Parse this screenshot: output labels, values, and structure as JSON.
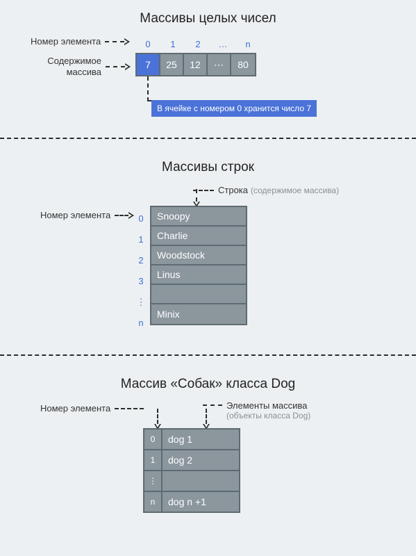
{
  "section1": {
    "title": "Массивы целых чисел",
    "label_index": "Номер элемента",
    "label_content": "Содержимое массива",
    "indices": [
      "0",
      "1",
      "2",
      "…",
      "n"
    ],
    "cells": [
      "7",
      "25",
      "12",
      "⋯",
      "80"
    ],
    "callout": "В ячейке с номером 0 хранится число 7"
  },
  "section2": {
    "title": "Массивы строк",
    "label_top_main": "Строка",
    "label_top_sub": "(содержимое массива)",
    "label_left": "Номер элемента",
    "indices": [
      "0",
      "1",
      "2",
      "3",
      "⋮",
      "n"
    ],
    "rows": [
      "Snoopy",
      "Charlie",
      "Woodstock",
      "Linus",
      "",
      "Minix"
    ]
  },
  "section3": {
    "title": "Массив «Собак» класса Dog",
    "label_left": "Номер элемента",
    "label_right_main": "Элементы массива",
    "label_right_sub": "(объекты класса Dog)",
    "rows": [
      {
        "idx": "0",
        "val": "dog 1"
      },
      {
        "idx": "1",
        "val": "dog 2"
      },
      {
        "idx": "⋮",
        "val": ""
      },
      {
        "idx": "n",
        "val": "dog n +1"
      }
    ]
  }
}
